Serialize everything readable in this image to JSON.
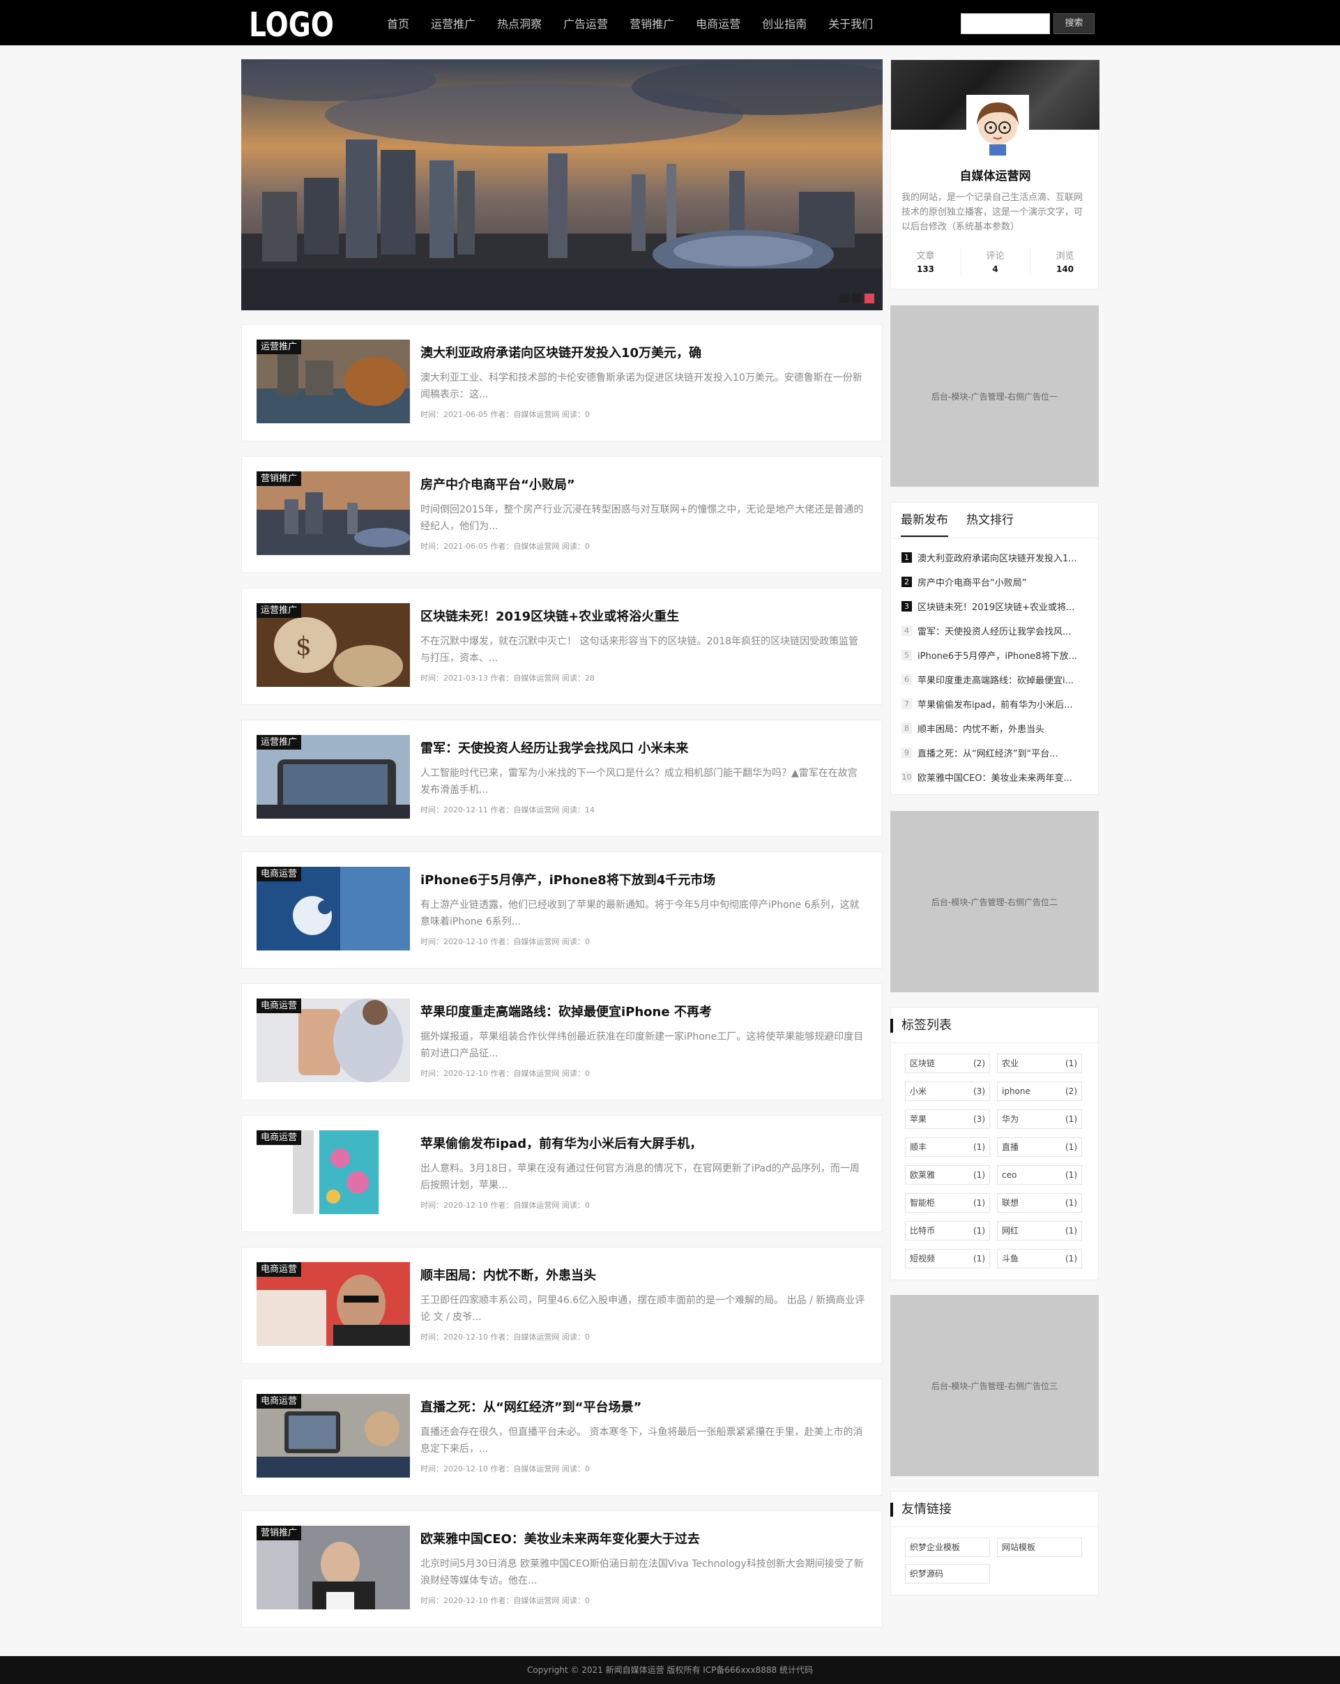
{
  "header": {
    "logo_text": "LOGO",
    "nav": [
      "首页",
      "运营推广",
      "热点洞察",
      "广告运营",
      "营销推广",
      "电商运营",
      "创业指南",
      "关于我们"
    ],
    "search_placeholder": "",
    "search_button": "搜索"
  },
  "articles": [
    {
      "tag": "运营推广",
      "title": "澳大利亚政府承诺向区块链开发投入10万美元，确",
      "excerpt": "澳大利亚工业、科学和技术部的卡伦安德鲁斯承诺为促进区块链开发投入10万美元。安德鲁斯在一份新闻稿表示：这...",
      "meta": "时间：2021-06-05  作者：自媒体运营网  阅读：0"
    },
    {
      "tag": "营销推广",
      "title": "房产中介电商平台“小败局”",
      "excerpt": "时间倒回2015年，整个房产行业沉浸在转型困惑与对互联网+的憧憬之中，无论是地产大佬还是普通的经纪人，他们为...",
      "meta": "时间：2021-06-05  作者：自媒体运营网  阅读：0"
    },
    {
      "tag": "运营推广",
      "title": "区块链未死！2019区块链+农业或将浴火重生",
      "excerpt": "不在沉默中爆发，就在沉默中灭亡！ 这句话来形容当下的区块链。2018年疯狂的区块链因受政策监管与打压，资本、...",
      "meta": "时间：2021-03-13  作者：自媒体运营网  阅读：28"
    },
    {
      "tag": "运营推广",
      "title": "雷军：天使投资人经历让我学会找风口 小米未来",
      "excerpt": "人工智能时代已来，雷军为小米找的下一个风口是什么？成立相机部门能干翻华为吗？▲雷军在在故宫发布滑盖手机...",
      "meta": "时间：2020-12-11  作者：自媒体运营网  阅读：14"
    },
    {
      "tag": "电商运营",
      "title": "iPhone6于5月停产，iPhone8将下放到4千元市场",
      "excerpt": "有上游产业链透露，他们已经收到了苹果的最新通知。将于今年5月中旬彻底停产iPhone 6系列，这就意味着iPhone 6系列...",
      "meta": "时间：2020-12-10  作者：自媒体运营网  阅读：0"
    },
    {
      "tag": "电商运营",
      "title": "苹果印度重走高端路线：砍掉最便宜iPhone 不再考",
      "excerpt": "据外媒报道，苹果组装合作伙伴纬创最近获准在印度新建一家iPhone工厂。这将使苹果能够规避印度目前对进口产品征...",
      "meta": "时间：2020-12-10  作者：自媒体运营网  阅读：0"
    },
    {
      "tag": "电商运营",
      "title": "苹果偷偷发布ipad，前有华为小米后有大屏手机，",
      "excerpt": "出人意料。3月18日，苹果在没有通过任何官方消息的情况下，在官网更新了iPad的产品序列，而一周后按照计划，苹果...",
      "meta": "时间：2020-12-10  作者：自媒体运营网  阅读：0"
    },
    {
      "tag": "电商运营",
      "title": "顺丰困局：内忧不断，外患当头",
      "excerpt": "王卫即任四家顺丰系公司，阿里46.6亿入股申通，摆在顺丰面前的是一个难解的局。 出品 / 新摘商业评论 文 / 皮爷...",
      "meta": "时间：2020-12-10  作者：自媒体运营网  阅读：0"
    },
    {
      "tag": "电商运营",
      "title": "直播之死：从“网红经济”到“平台场景”",
      "excerpt": "直播还会存在很久，但直播平台未必。 资本寒冬下，斗鱼将最后一张船票紧紧攥在手里，赴美上市的消息定下来后，...",
      "meta": "时间：2020-12-10  作者：自媒体运营网  阅读：0"
    },
    {
      "tag": "营销推广",
      "title": "欧莱雅中国CEO：美妆业未来两年变化要大于过去",
      "excerpt": "北京时间5月30日消息 欧莱雅中国CEO斯伯涵日前在法国Viva Technology科技创新大会期间接受了新浪财经等媒体专访。他在...",
      "meta": "时间：2020-12-10  作者：自媒体运营网  阅读：0"
    }
  ],
  "profile": {
    "name": "自媒体运营网",
    "desc": "我的网站，是一个记录自己生活点滴、互联网技术的原创独立播客，这是一个演示文字，可以后台修改（系统基本参数）",
    "stats": [
      {
        "label": "文章",
        "value": "133"
      },
      {
        "label": "评论",
        "value": "4"
      },
      {
        "label": "浏览",
        "value": "140"
      }
    ]
  },
  "ads": [
    "后台-模块-广告管理-右侧广告位一",
    "后台-模块-广告管理-右侧广告位二",
    "后台-模块-广告管理-右侧广告位三"
  ],
  "tabs": {
    "labels": [
      "最新发布",
      "热文排行"
    ],
    "items": [
      "澳大利亚政府承诺向区块链开发投入1...",
      "房产中介电商平台“小败局”",
      "区块链未死！2019区块链+农业或将...",
      "雷军：天使投资人经历让我学会找风...",
      "iPhone6于5月停产，iPhone8将下放...",
      "苹果印度重走高端路线：砍掉最便宜i...",
      "苹果偷偷发布ipad，前有华为小米后...",
      "顺丰困局：内忧不断，外患当头",
      "直播之死：从“网红经济”到“平台...",
      "欧莱雅中国CEO：美妆业未来两年变..."
    ]
  },
  "tags_section": {
    "title": "标签列表",
    "tags": [
      {
        "name": "区块链",
        "count": "(2)"
      },
      {
        "name": "农业",
        "count": "(1)"
      },
      {
        "name": "小米",
        "count": "(3)"
      },
      {
        "name": "iphone",
        "count": "(2)"
      },
      {
        "name": "苹果",
        "count": "(3)"
      },
      {
        "name": "华为",
        "count": "(1)"
      },
      {
        "name": "顺丰",
        "count": "(1)"
      },
      {
        "name": "直播",
        "count": "(1)"
      },
      {
        "name": "欧莱雅",
        "count": "(1)"
      },
      {
        "name": "ceo",
        "count": "(1)"
      },
      {
        "name": "智能柜",
        "count": "(1)"
      },
      {
        "name": "联想",
        "count": "(1)"
      },
      {
        "name": "比特币",
        "count": "(1)"
      },
      {
        "name": "网红",
        "count": "(1)"
      },
      {
        "name": "短视频",
        "count": "(1)"
      },
      {
        "name": "斗鱼",
        "count": "(1)"
      }
    ]
  },
  "links_section": {
    "title": "友情链接",
    "links": [
      "织梦企业模板",
      "网站模板",
      "织梦源码"
    ]
  },
  "footer": {
    "text": "Copyright © 2021 新闻自媒体运营 版权所有  ICP备666xxx8888  统计代码"
  }
}
